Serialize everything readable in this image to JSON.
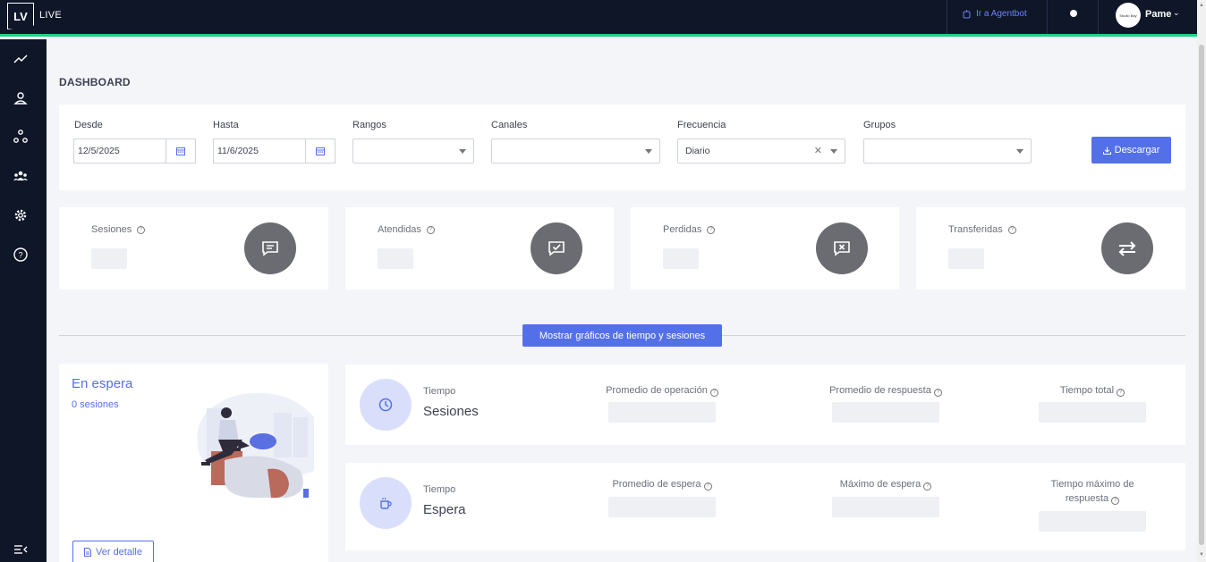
{
  "header": {
    "logo_text": "LV",
    "app_name": "LIVE",
    "agentbot_label": "Ir a Agentbot",
    "avatar_text": "Studio Bay",
    "user_name": "Pame"
  },
  "sidebar": {
    "items": [
      {
        "icon": "trend-icon"
      },
      {
        "icon": "user-icon"
      },
      {
        "icon": "network-icon"
      },
      {
        "icon": "team-icon"
      },
      {
        "icon": "gear-icon"
      },
      {
        "icon": "help-icon"
      },
      {
        "icon": "collapse-menu-icon"
      }
    ]
  },
  "page": {
    "title": "DASHBOARD"
  },
  "filters": {
    "desde_label": "Desde",
    "desde_value": "12/5/2025",
    "hasta_label": "Hasta",
    "hasta_value": "11/6/2025",
    "rangos_label": "Rangos",
    "rangos_value": "",
    "canales_label": "Canales",
    "canales_value": "",
    "frecuencia_label": "Frecuencia",
    "frecuencia_value": "Diario",
    "grupos_label": "Grupos",
    "grupos_value": "",
    "download_label": "Descargar"
  },
  "stats": [
    {
      "label": "Sesiones",
      "icon": "chat-icon"
    },
    {
      "label": "Atendidas",
      "icon": "chat-check-icon"
    },
    {
      "label": "Perdidas",
      "icon": "chat-x-icon"
    },
    {
      "label": "Transferidas",
      "icon": "transfer-icon"
    }
  ],
  "toggle_label": "Mostrar gráficos de tiempo y sesiones",
  "waiting": {
    "title": "En espera",
    "count": "0 sesiones",
    "detail_label": "Ver detalle"
  },
  "metrics": {
    "sessions": {
      "small": "Tiempo",
      "big": "Sesiones",
      "col1": "Promedio de operación",
      "col2": "Promedio de respuesta",
      "col3": "Tiempo total"
    },
    "wait": {
      "small": "Tiempo",
      "big": "Espera",
      "col1": "Promedio de espera",
      "col2": "Máximo de espera",
      "col3": "Tiempo máximo de respuesta"
    }
  },
  "colors": {
    "accent": "#5470e8",
    "topbar": "#0e1628",
    "topbar_border": "#1fd27f",
    "stat_icon_bg": "#6b6c72"
  }
}
